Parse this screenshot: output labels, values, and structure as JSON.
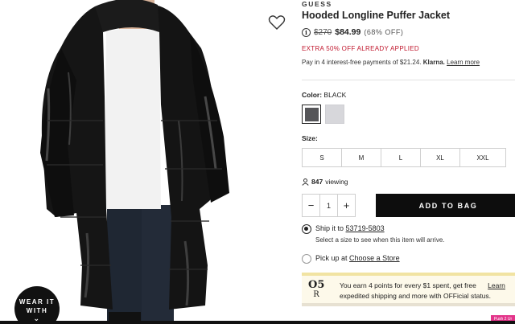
{
  "product": {
    "brand": "GUESS",
    "title": "Hooded Longline Puffer Jacket",
    "info_icon_text": "i",
    "price_old": "$270",
    "price_new": "$84.99",
    "price_off": "(68% OFF)",
    "promo": "EXTRA 50% OFF ALREADY APPLIED",
    "klarna_text": "Pay in 4 interest-free payments of $21.24.",
    "klarna_brand": "Klarna.",
    "klarna_learn": "Learn more"
  },
  "color": {
    "label": "Color:",
    "value": "BLACK",
    "swatches": [
      {
        "name": "black",
        "color": "#555558",
        "selected": true
      },
      {
        "name": "grey",
        "color": "#d7d7db",
        "selected": false
      }
    ]
  },
  "size": {
    "label": "Size:",
    "options": [
      "S",
      "M",
      "L",
      "XL",
      "XXL"
    ]
  },
  "viewing": {
    "count": "847",
    "label": "viewing"
  },
  "quantity": {
    "minus": "−",
    "value": "1",
    "plus": "+"
  },
  "cta": {
    "add_to_bag": "ADD TO BAG"
  },
  "fulfillment": {
    "ship_label": "Ship it to",
    "zip": "53719-5803",
    "ship_note": "Select a size to see when this item will arrive.",
    "pickup_label": "Pick up at",
    "pickup_link": "Choose a Store"
  },
  "rewards": {
    "logo_top": "O5",
    "logo_bottom": "R",
    "line1": "You earn 4 points for every $1 spent, get free",
    "line1_link": "Learn",
    "line2": "expedited shipping and more with OFFicial status."
  },
  "badges": {
    "wear_line1": "WEAR IT",
    "wear_line2": "WITH",
    "wear_chevron": "⌄",
    "feedback": "Push 2 Ur"
  },
  "theme": {
    "accent_red": "#c0172d",
    "cta_bg": "#0d0d0d"
  }
}
